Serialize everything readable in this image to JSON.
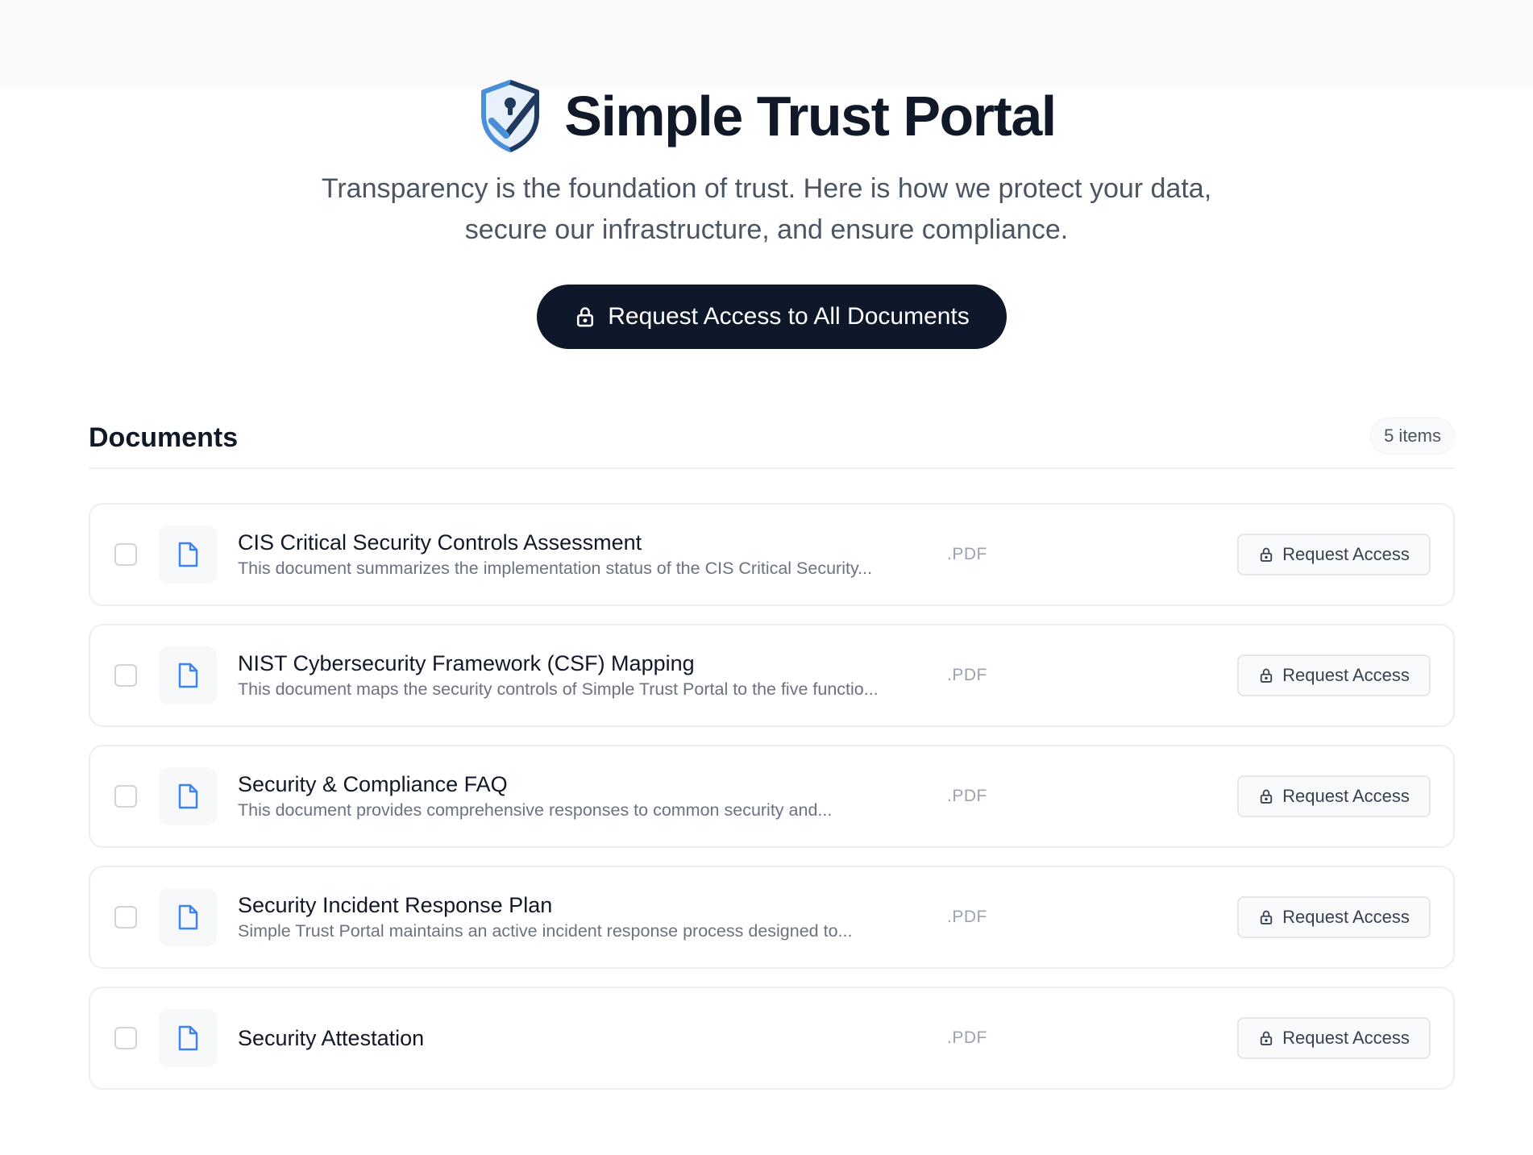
{
  "hero": {
    "title": "Simple Trust Portal",
    "logo_icon": "shield-keyhole-check-icon",
    "subtitle_line1": "Transparency is the foundation of trust. Here is how we protect your data,",
    "subtitle_line2": "secure our infrastructure, and ensure compliance.",
    "cta_label": "Request Access to All Documents",
    "cta_icon": "lock-icon"
  },
  "documents": {
    "heading": "Documents",
    "count_label": "5 items",
    "items": [
      {
        "title": "CIS Critical Security Controls Assessment",
        "description": "This document summarizes the implementation status of the CIS Critical Security...",
        "type": ".PDF",
        "action": "Request Access"
      },
      {
        "title": "NIST Cybersecurity Framework (CSF) Mapping",
        "description": "This document maps the security controls of Simple Trust Portal to the five functio...",
        "type": ".PDF",
        "action": "Request Access"
      },
      {
        "title": "Security & Compliance FAQ",
        "description": "This document provides comprehensive responses to common security and...",
        "type": ".PDF",
        "action": "Request Access"
      },
      {
        "title": "Security Incident Response Plan",
        "description": "Simple Trust Portal maintains an active incident response process designed to...",
        "type": ".PDF",
        "action": "Request Access"
      },
      {
        "title": "Security Attestation",
        "description": "",
        "type": ".PDF",
        "action": "Request Access"
      }
    ]
  },
  "colors": {
    "primary_dark": "#0f172a",
    "accent_blue": "#3b82f6",
    "muted_text": "#6b7280"
  }
}
